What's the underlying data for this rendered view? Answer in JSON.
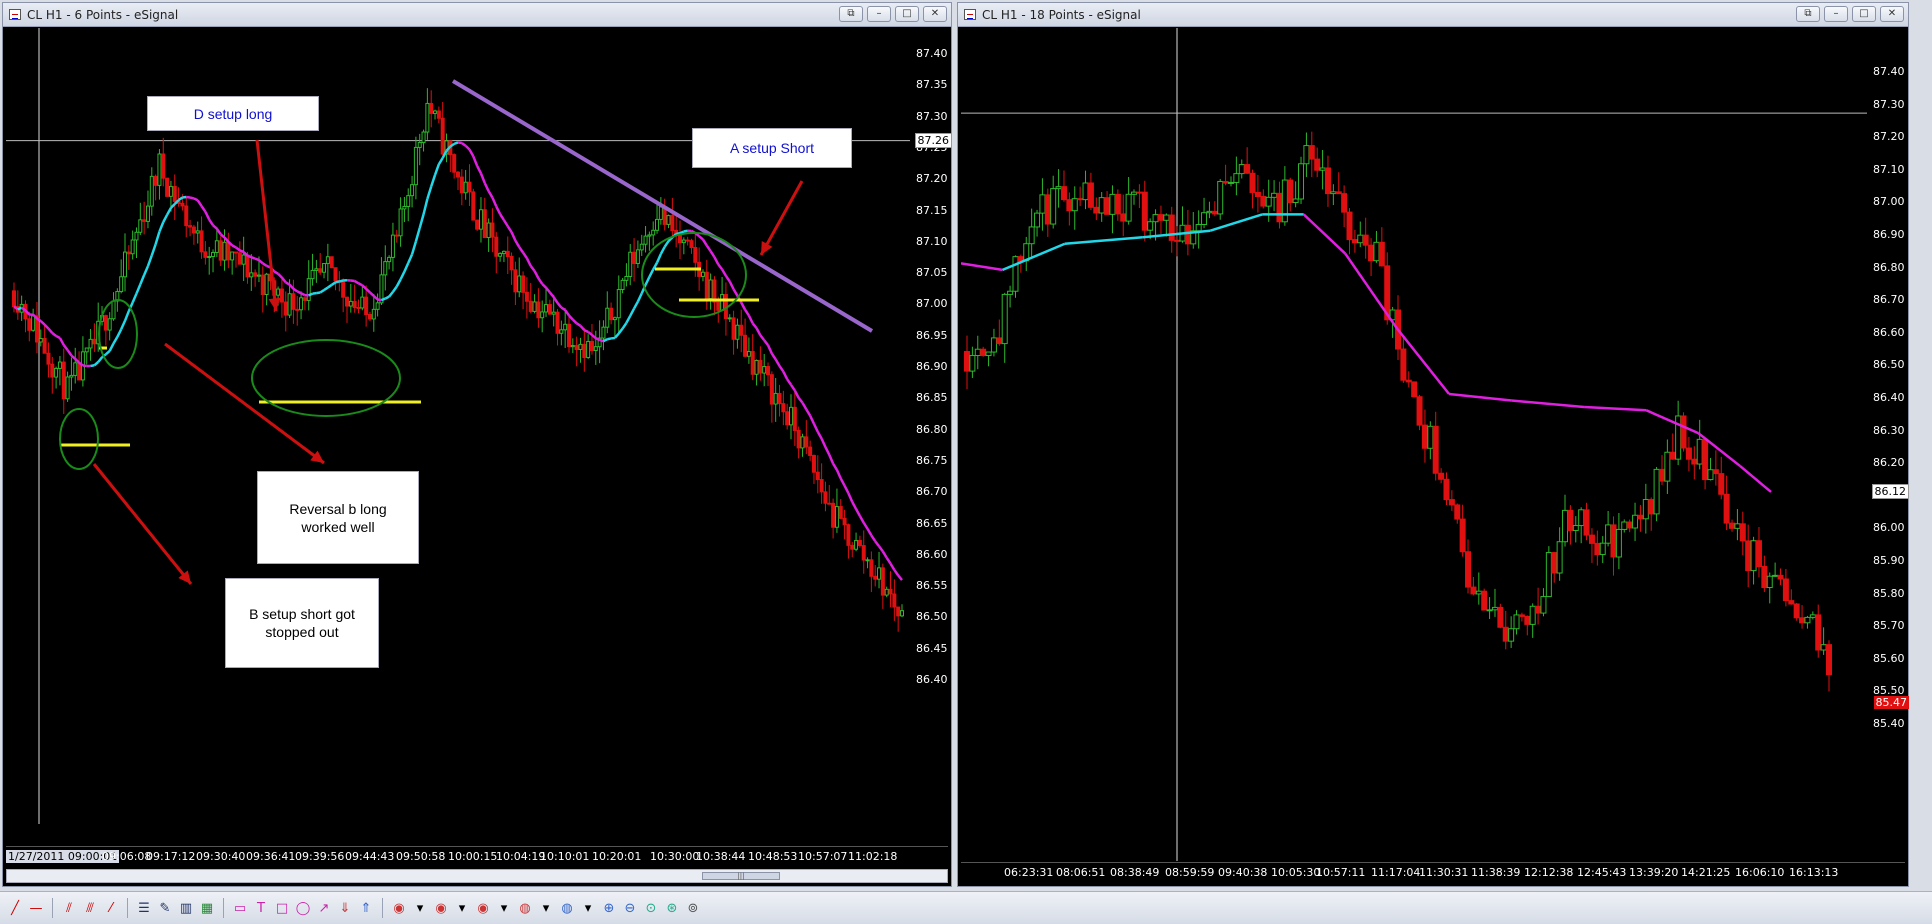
{
  "left_chart": {
    "title": "CL H1 - 6 Points - eSignal",
    "price_ticks": [
      "87.40",
      "87.35",
      "87.30",
      "87.25",
      "87.20",
      "87.15",
      "87.10",
      "87.05",
      "87.00",
      "86.95",
      "86.90",
      "86.85",
      "86.80",
      "86.75",
      "86.70",
      "86.65",
      "86.60",
      "86.55",
      "86.50",
      "86.45",
      "86.40"
    ],
    "current_price": "87.26",
    "time_ticks": [
      "1/27/2011 09:00:01",
      "09:06:08",
      "09:17:12",
      "09:30:40",
      "09:36:41",
      "09:39:56",
      "09:44:43",
      "09:50:58",
      "10:00:15",
      "10:04:19",
      "10:10:01",
      "10:20:01",
      "10:30:00",
      "10:38:44",
      "10:48:53",
      "10:57:07",
      "11:02:18"
    ],
    "annotations": {
      "d_setup": "D setup long",
      "a_setup": "A setup Short",
      "reversal_line1": "Reversal b long",
      "reversal_line2": "worked well",
      "b_setup_line1": "B setup short got",
      "b_setup_line2": "stopped out"
    },
    "scroll_thumb": "|||"
  },
  "right_chart": {
    "title": "CL H1 - 18 Points - eSignal",
    "price_ticks": [
      "87.40",
      "87.30",
      "87.20",
      "87.10",
      "87.00",
      "86.90",
      "86.80",
      "86.70",
      "86.60",
      "86.50",
      "86.40",
      "86.30",
      "86.20",
      "86.10",
      "86.00",
      "85.90",
      "85.80",
      "85.70",
      "85.60",
      "85.50",
      "85.40"
    ],
    "current_price": "86.12",
    "last_price": "85.47",
    "time_ticks": [
      "06:23:31",
      "08:06:51",
      "08:38:49",
      "08:59:59",
      "09:40:38",
      "10:05:30",
      "10:57:11",
      "11:17:04",
      "11:30:31",
      "11:38:39",
      "12:12:38",
      "12:45:43",
      "13:39:20",
      "14:21:25",
      "16:06:10",
      "16:13:13"
    ]
  },
  "colors": {
    "up": "#2db82d",
    "down": "#e01010",
    "ma_up": "#22d8e8",
    "ma_down": "#e020e0",
    "trendline": "#9966cc",
    "setup_line": "#f0f020",
    "arrow": "#cc1010",
    "circle": "#1a8a1a"
  },
  "window_buttons": [
    "restore-icon",
    "minimize-icon",
    "maximize-icon",
    "close-icon"
  ],
  "toolbar_icons": [
    "pencil-icon",
    "hline-icon",
    "channel-icon",
    "fib-icon",
    "brush-icon",
    "bars-icon",
    "draw-icon",
    "grid-icon",
    "rect-icon",
    "text-icon",
    "square-icon",
    "ellipse-icon",
    "arrow-up-icon",
    "down-arrow-icon",
    "up-arrow-icon",
    "tick-icon",
    "vol-icon",
    "rng-icon",
    "color-icon",
    "globe-icon",
    "zoom-in-icon",
    "zoom-out-icon",
    "reset-icon",
    "undo-icon",
    "redo-icon"
  ]
}
